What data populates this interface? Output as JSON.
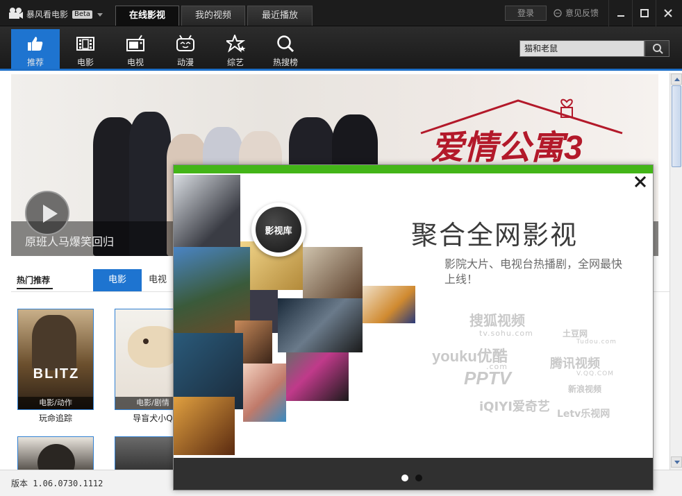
{
  "window": {
    "app_name": "暴风看电影",
    "beta_badge": "Beta",
    "tabs": [
      {
        "label": "在线影视",
        "active": true
      },
      {
        "label": "我的视频",
        "active": false
      },
      {
        "label": "最近播放",
        "active": false
      }
    ],
    "login_label": "登录",
    "feedback_label": "意见反馈"
  },
  "nav": {
    "items": [
      {
        "label": "推荐",
        "icon": "thumbs-up-icon",
        "active": true
      },
      {
        "label": "电影",
        "icon": "film-icon",
        "active": false
      },
      {
        "label": "电视",
        "icon": "tv-icon",
        "active": false
      },
      {
        "label": "动漫",
        "icon": "anime-icon",
        "active": false
      },
      {
        "label": "综艺",
        "icon": "star-icon",
        "active": false
      },
      {
        "label": "热搜榜",
        "icon": "search-icon",
        "active": false
      }
    ],
    "search_value": "猫和老鼠"
  },
  "banner": {
    "caption": "原班人马爆笑回归",
    "title_art": "爱情公寓3"
  },
  "section": {
    "title": "热门推荐",
    "tabs": [
      {
        "label": "电影",
        "active": true
      },
      {
        "label": "电视",
        "active": false
      }
    ]
  },
  "posters": [
    {
      "title": "玩命追踪",
      "genre": "电影/动作",
      "art_text": "BLITZ"
    },
    {
      "title": "导盲犬小Q",
      "genre": "电影/剧情",
      "art_text": ""
    }
  ],
  "status": {
    "version": "版本 1.06.0730.1112"
  },
  "popup": {
    "badge": "影视库",
    "headline": "聚合全网影视",
    "description": "影院大片、电视台热播剧，全网最快上线！",
    "partners": [
      {
        "name": "搜狐视频",
        "sub": "tv.sohu.com"
      },
      {
        "name": "土豆网",
        "sub": "Tudou.com"
      },
      {
        "name": "youku优酷",
        "sub": ".com"
      },
      {
        "name": "腾讯视频",
        "sub": "V.QQ.COM"
      },
      {
        "name": "PPTV",
        "sub": ""
      },
      {
        "name": "新浪视频",
        "sub": ""
      },
      {
        "name": "iQIYI爱奇艺",
        "sub": ""
      },
      {
        "name": "Letv乐视网",
        "sub": ""
      }
    ],
    "page_count": 2,
    "active_page": 1
  },
  "colors": {
    "accent_blue": "#1e74d0",
    "popup_green": "#43b518",
    "titlebar": "#1c1c1c"
  }
}
